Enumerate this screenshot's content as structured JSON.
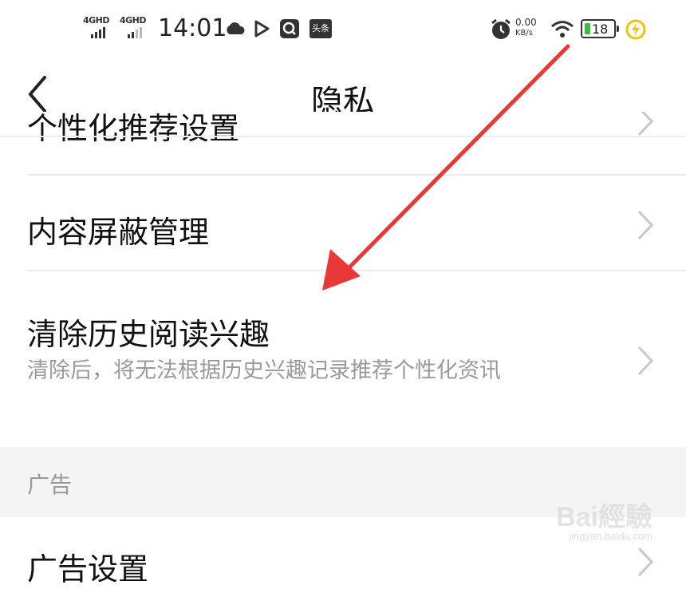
{
  "status_bar": {
    "sim1": "4GHD",
    "sim2": "4GHD",
    "time": "14:01",
    "net_speed_value": "0.00",
    "net_speed_unit": "KB/s",
    "battery": "18",
    "app_icon_label": "头条",
    "icons": [
      "cloud-icon",
      "play-icon",
      "search-app-icon",
      "news-app-icon",
      "alarm-icon",
      "wifi-icon",
      "battery-icon",
      "charging-icon"
    ]
  },
  "header": {
    "title": "隐私",
    "back_icon": "chevron-left-icon"
  },
  "settings": {
    "partial_item": "个性化推荐设置",
    "content_block": "内容屏蔽管理",
    "clear_history": "清除历史阅读兴趣",
    "clear_history_desc": "清除后，将无法根据历史兴趣记录推荐个性化资讯",
    "ad_section_title": "广告",
    "ad_settings": "广告设置"
  },
  "watermark": {
    "brand": "Bai經驗",
    "url": "jingyan.baidu.com"
  },
  "colors": {
    "annotation_arrow": "#e83838",
    "battery_green": "#3dbb3d",
    "charging_yellow": "#f5c400",
    "section_bg": "#f4f4f4"
  }
}
